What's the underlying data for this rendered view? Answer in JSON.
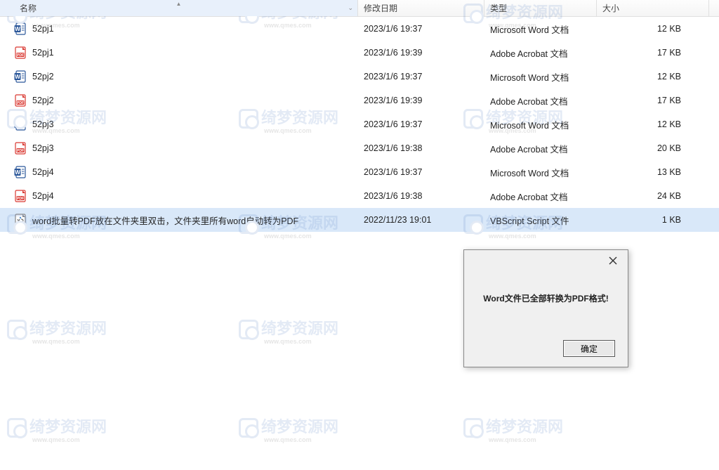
{
  "columns": {
    "name": "名称",
    "date": "修改日期",
    "type": "类型",
    "size": "大小"
  },
  "files": [
    {
      "icon": "word",
      "name": "52pj1",
      "date": "2023/1/6 19:37",
      "type": "Microsoft Word 文档",
      "size": "12 KB",
      "selected": false
    },
    {
      "icon": "pdf",
      "name": "52pj1",
      "date": "2023/1/6 19:39",
      "type": "Adobe Acrobat 文档",
      "size": "17 KB",
      "selected": false
    },
    {
      "icon": "word",
      "name": "52pj2",
      "date": "2023/1/6 19:37",
      "type": "Microsoft Word 文档",
      "size": "12 KB",
      "selected": false
    },
    {
      "icon": "pdf",
      "name": "52pj2",
      "date": "2023/1/6 19:39",
      "type": "Adobe Acrobat 文档",
      "size": "17 KB",
      "selected": false
    },
    {
      "icon": "word",
      "name": "52pj3",
      "date": "2023/1/6 19:37",
      "type": "Microsoft Word 文档",
      "size": "12 KB",
      "selected": false
    },
    {
      "icon": "pdf",
      "name": "52pj3",
      "date": "2023/1/6 19:38",
      "type": "Adobe Acrobat 文档",
      "size": "20 KB",
      "selected": false
    },
    {
      "icon": "word",
      "name": "52pj4",
      "date": "2023/1/6 19:37",
      "type": "Microsoft Word 文档",
      "size": "13 KB",
      "selected": false
    },
    {
      "icon": "pdf",
      "name": "52pj4",
      "date": "2023/1/6 19:38",
      "type": "Adobe Acrobat 文档",
      "size": "24 KB",
      "selected": false
    },
    {
      "icon": "vbs",
      "name": "word批量转PDF放在文件夹里双击，文件夹里所有word自动转为PDF",
      "date": "2022/11/23 19:01",
      "type": "VBScript Script 文件",
      "size": "1 KB",
      "selected": true
    }
  ],
  "dialog": {
    "message": "Word文件已全部轩换为PDF格式!",
    "ok_label": "确定"
  },
  "watermark": {
    "text": "绮梦资源网",
    "sub": "www.qmes.com"
  },
  "icons": {
    "word_color": "#2B579A",
    "pdf_color": "#D93831",
    "vbs_color": "#6A6A6A"
  }
}
